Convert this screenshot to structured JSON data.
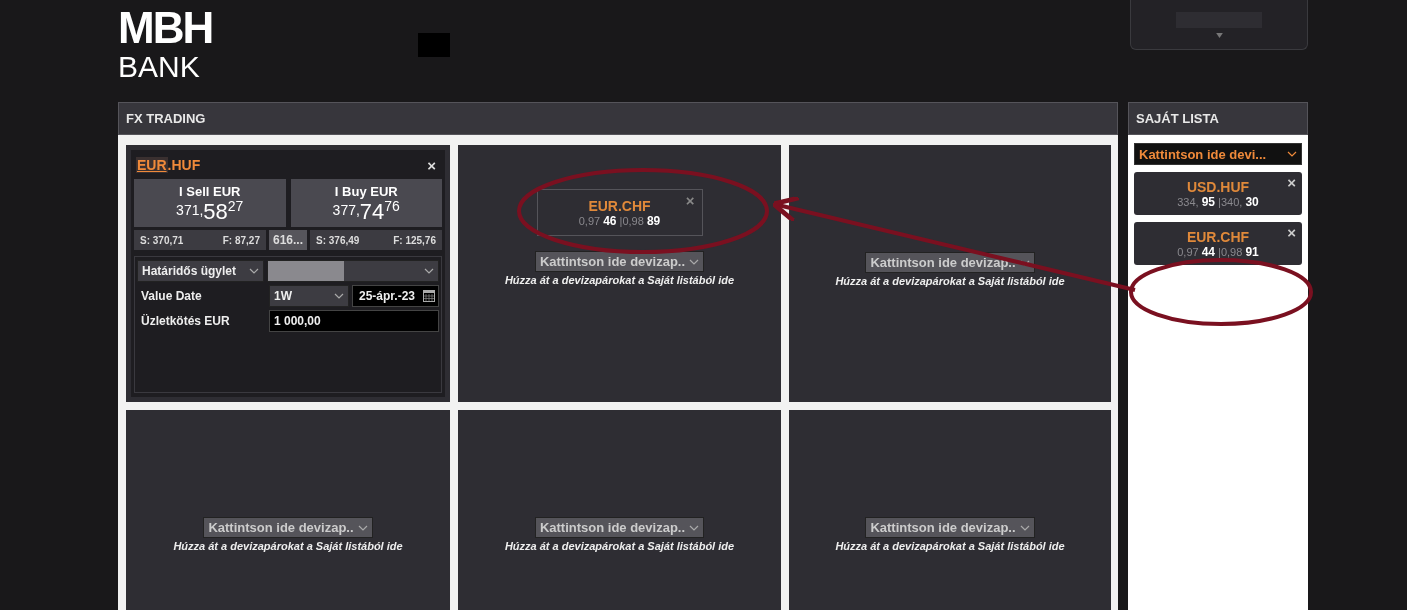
{
  "logo": {
    "line_1": "MBH",
    "line_2": "BANK"
  },
  "fx_trading": {
    "title": "FX TRADING",
    "tiles": [
      {
        "kind": "deal",
        "base": "EUR",
        "rest": ".HUF",
        "close": "×",
        "sell": {
          "label": "I Sell EUR",
          "big": "371,",
          "pips": "58",
          "frac": "27",
          "s": "S: 370,71",
          "f": "F: 87,27"
        },
        "spread": "616...",
        "buy": {
          "label": "I Buy EUR",
          "big": "377,",
          "pips": "74",
          "frac": "76",
          "s": "S: 376,49",
          "f": "F: 125,76"
        },
        "deal_type": "Határidős ügylet",
        "value_date_label": "Value Date",
        "tenor": "1W",
        "date": "25-ápr.-23",
        "amount_label": "Üzletkötés EUR",
        "amount": "1 000,00"
      },
      {
        "kind": "drop",
        "pair": {
          "name": "EUR.CHF",
          "close": "×",
          "rates": "0,97 **46** |0,98 **89**"
        },
        "selector": "Kattintson ide devizap..",
        "hint": "Húzza át a devizapárokat a Saját listából ide"
      },
      {
        "kind": "drop",
        "selector": "Kattintson ide devizap..",
        "hint": "Húzza át a devizapárokat a Saját listából ide"
      },
      {
        "kind": "drop",
        "selector": "Kattintson ide devizap..",
        "hint": "Húzza át a devizapárokat a Saját listából ide"
      },
      {
        "kind": "drop",
        "selector": "Kattintson ide devizap..",
        "hint": "Húzza át a devizapárokat a Saját listából ide"
      },
      {
        "kind": "drop",
        "selector": "Kattintson ide devizap..",
        "hint": "Húzza át a devizapárokat a Saját listából ide"
      }
    ]
  },
  "saved_list": {
    "title": "SAJÁT LISTA",
    "selector": "Kattintson ide devi...",
    "pairs": [
      {
        "name": "USD.HUF",
        "close": "×",
        "rates": "334, **95** |340, **30**"
      },
      {
        "name": "EUR.CHF",
        "close": "×",
        "rates": "0,97 **44** |0,98 **91**"
      }
    ]
  }
}
